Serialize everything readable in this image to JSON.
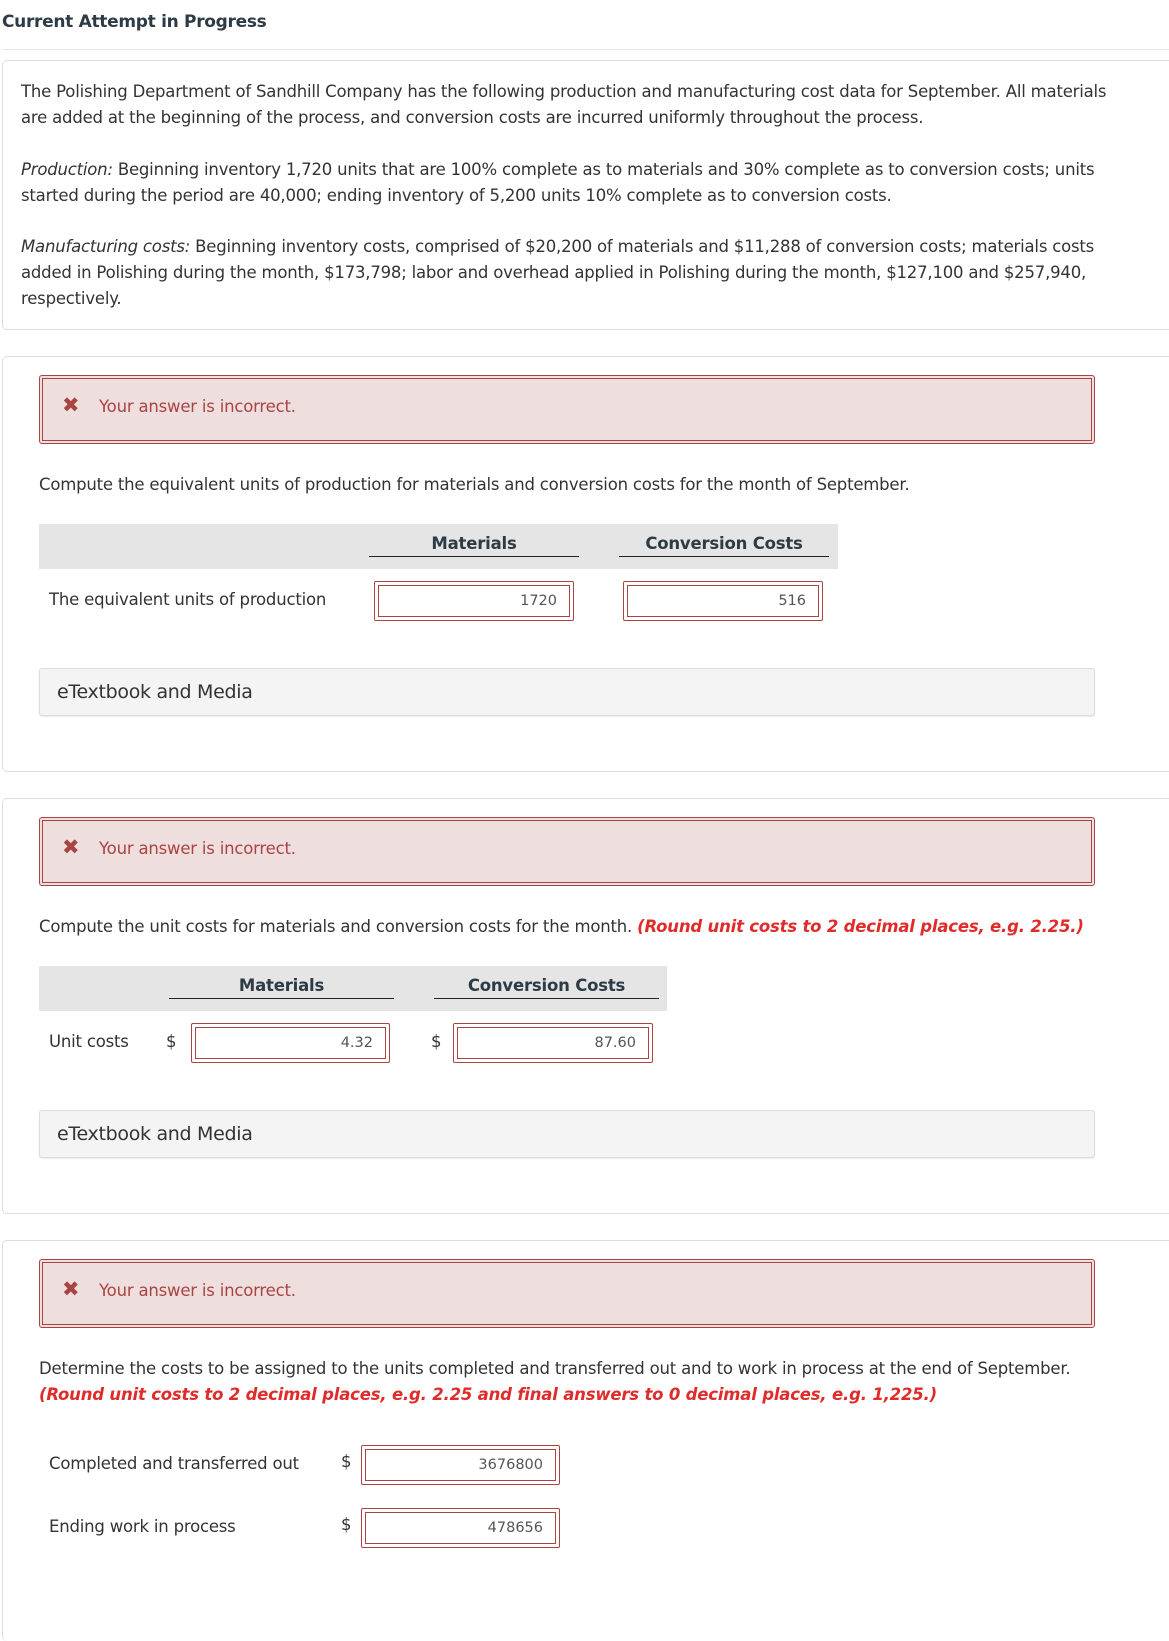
{
  "header": {
    "title": "Current Attempt in Progress"
  },
  "problem": {
    "intro": "The Polishing Department of Sandhill Company has the following production and manufacturing cost data for September. All materials are added at the beginning of the process, and conversion costs are incurred uniformly throughout the process.",
    "production_label": "Production:",
    "production_text": " Beginning inventory 1,720 units that are 100% complete as to materials and 30% complete as to conversion costs; units started during the period are 40,000; ending inventory of 5,200 units 10% complete as to conversion costs.",
    "manufacturing_label": "Manufacturing costs:",
    "manufacturing_text": " Beginning inventory costs, comprised of $20,200 of materials and $11,288 of conversion costs; materials costs added in Polishing during the month, $173,798; labor and overhead applied in Polishing during the month, $127,100 and $257,940, respectively."
  },
  "parts": [
    {
      "feedback": "Your answer is incorrect.",
      "question": "Compute the equivalent units of production for materials and conversion costs for the month of September.",
      "columns": [
        "Materials",
        "Conversion Costs"
      ],
      "row_label": "The equivalent units of production",
      "values": [
        "1720",
        "516"
      ],
      "media_label": "eTextbook and Media"
    },
    {
      "feedback": "Your answer is incorrect.",
      "question": "Compute the unit costs for materials and conversion costs for the month.",
      "instruction": "(Round unit costs to 2 decimal places, e.g. 2.25.)",
      "columns": [
        "Materials",
        "Conversion Costs"
      ],
      "row_label": "Unit costs",
      "currency": "$",
      "values": [
        "4.32",
        "87.60"
      ],
      "media_label": "eTextbook and Media"
    },
    {
      "feedback": "Your answer is incorrect.",
      "question": "Determine the costs to be assigned to the units completed and transferred out and to work in process at the end of September.",
      "instruction": "(Round unit costs to 2 decimal places, e.g. 2.25 and final answers to 0 decimal places, e.g. 1,225.)",
      "currency": "$",
      "rows": [
        {
          "label": "Completed and transferred out",
          "value": "3676800"
        },
        {
          "label": "Ending work in process",
          "value": "478656"
        }
      ]
    }
  ],
  "colors": {
    "error": "#a94442",
    "error_bg": "#eedede",
    "instruction_red": "#e02b2b"
  }
}
